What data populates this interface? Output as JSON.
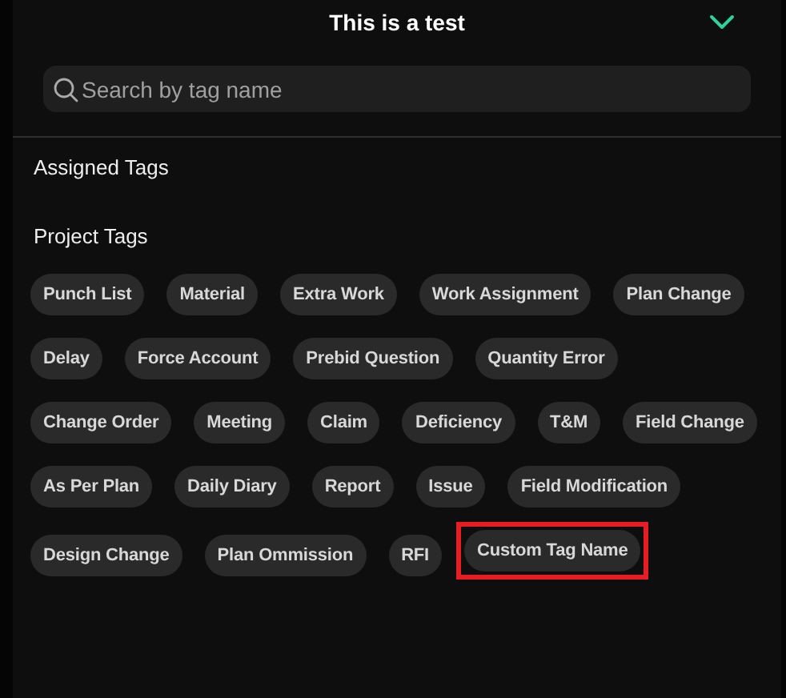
{
  "header": {
    "title": "This is a test",
    "expanded": true
  },
  "search": {
    "placeholder": "Search by tag name"
  },
  "assigned_tags": {
    "heading": "Assigned Tags"
  },
  "project_tags": {
    "heading": "Project Tags",
    "tags": [
      {
        "label": "Punch List",
        "highlighted": false
      },
      {
        "label": "Material",
        "highlighted": false
      },
      {
        "label": "Extra Work",
        "highlighted": false
      },
      {
        "label": "Work Assignment",
        "highlighted": false
      },
      {
        "label": "Plan Change",
        "highlighted": false
      },
      {
        "label": "Delay",
        "highlighted": false
      },
      {
        "label": "Force Account",
        "highlighted": false
      },
      {
        "label": "Prebid Question",
        "highlighted": false
      },
      {
        "label": "Quantity Error",
        "highlighted": false
      },
      {
        "label": "Change Order",
        "highlighted": false
      },
      {
        "label": "Meeting",
        "highlighted": false
      },
      {
        "label": "Claim",
        "highlighted": false
      },
      {
        "label": "Deficiency",
        "highlighted": false
      },
      {
        "label": "T&M",
        "highlighted": false
      },
      {
        "label": "Field Change",
        "highlighted": false
      },
      {
        "label": "As Per Plan",
        "highlighted": false
      },
      {
        "label": "Daily Diary",
        "highlighted": false
      },
      {
        "label": "Report",
        "highlighted": false
      },
      {
        "label": "Issue",
        "highlighted": false
      },
      {
        "label": "Field Modification",
        "highlighted": false
      },
      {
        "label": "Design Change",
        "highlighted": false
      },
      {
        "label": "Plan Ommission",
        "highlighted": false
      },
      {
        "label": "RFI",
        "highlighted": false
      },
      {
        "label": "Custom Tag Name",
        "highlighted": true
      }
    ]
  }
}
